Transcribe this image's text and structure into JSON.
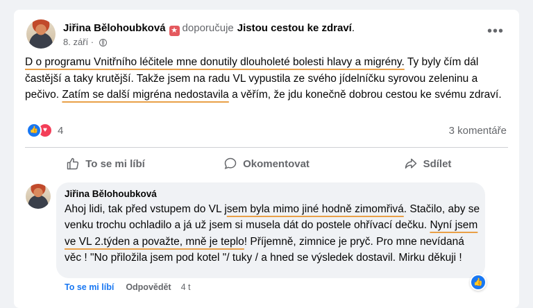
{
  "post": {
    "author": "Jiřina Bělohoubková",
    "verb": "doporučuje",
    "page": "Jistou cestou ke zdraví",
    "period": ".",
    "date": "8. září",
    "text": {
      "u1": "D o programu Vnitřního léčitele mne donutily dlouholeté bolesti hlavy a migrény.",
      "t1": " Ty  byly čím dál častější a taky krutější. Takže jsem na radu VL vypustila ze svého jídelníčku syrovou zeleninu a pečivo. ",
      "u2": "Zatím se další migréna nedostavila",
      "t2": " a věřím, že jdu konečně dobrou cestou ke svému zdraví."
    },
    "reaction_count": "4",
    "comments_count": "3 komentáře",
    "colors": {
      "accent": "#1877f2",
      "love": "#f33e58",
      "underline": "#e9a047",
      "badge": "#e4595e"
    }
  },
  "actions": {
    "like": "To se mi líbí",
    "comment": "Okomentovat",
    "share": "Sdílet"
  },
  "comment": {
    "author": "Jiřina Bělohoubková",
    "text": {
      "t1": "Ahoj lidi, tak před vstupem do VL j",
      "u1": "sem byla mimo jiné hodně zimomřivá",
      "t2": ". Stačilo, aby se venku trochu ochladilo a já už jsem si musela dát do postele ohřívací dečku. ",
      "u2": "Nyní jsem ve VL 2.týden a považte, mně je teplo",
      "t3": "! Příjemně, zimnice je pryč. Pro mne nevídaná věc ! \"No přiložila jsem pod kotel \"/ tuky / a hned se výsledek dostavil. Mirku děkuji !"
    },
    "like": "To se mi líbí",
    "reply": "Odpovědět",
    "time": "4 t"
  },
  "icons": {
    "badge": "recommend-badge-icon",
    "globe": "globe-icon",
    "more": "more-options-icon",
    "like": "thumbs-up-icon",
    "love": "heart-icon",
    "comment": "comment-bubble-icon",
    "share": "share-arrow-icon"
  }
}
